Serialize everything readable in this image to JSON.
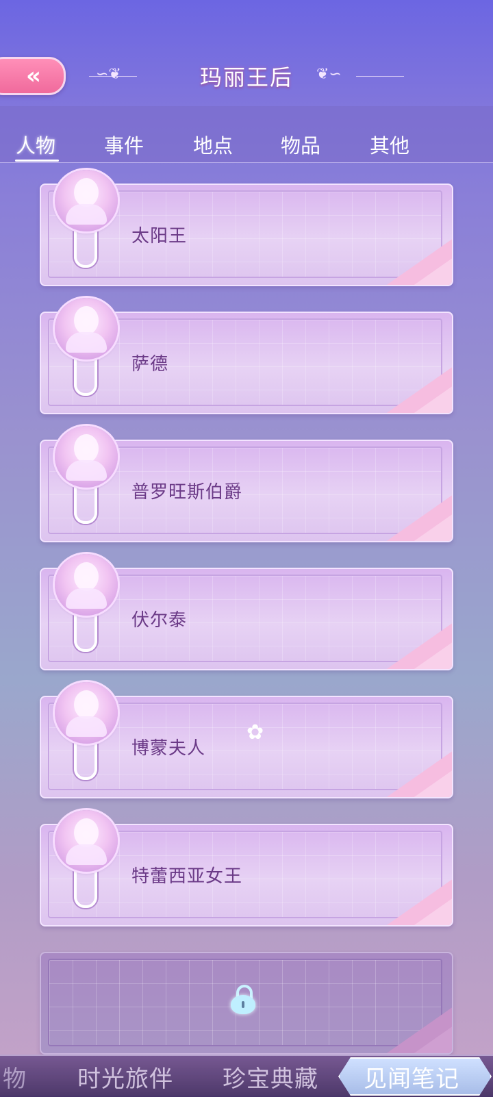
{
  "header": {
    "title": "玛丽王后",
    "back_label": "«"
  },
  "tabs": [
    {
      "label": "人物",
      "active": true
    },
    {
      "label": "事件",
      "active": false
    },
    {
      "label": "地点",
      "active": false
    },
    {
      "label": "物品",
      "active": false
    },
    {
      "label": "其他",
      "active": false
    }
  ],
  "cards": [
    {
      "name": "太阳王"
    },
    {
      "name": "萨德"
    },
    {
      "name": "普罗旺斯伯爵"
    },
    {
      "name": "伏尔泰"
    },
    {
      "name": "博蒙夫人"
    },
    {
      "name": "特蕾西亚女王"
    }
  ],
  "locked_card": {
    "icon": "heart-lock-icon"
  },
  "bottom_nav": {
    "partial": "物",
    "items": [
      {
        "label": "时光旅伴",
        "active": false
      },
      {
        "label": "珍宝典藏",
        "active": false
      },
      {
        "label": "见闻笔记",
        "active": true
      }
    ]
  },
  "colors": {
    "accent_pink": "#f06a9c",
    "card_bg": "#e3c8f2",
    "name_text": "#6b3a87",
    "lock_blue": "#bfefff"
  }
}
